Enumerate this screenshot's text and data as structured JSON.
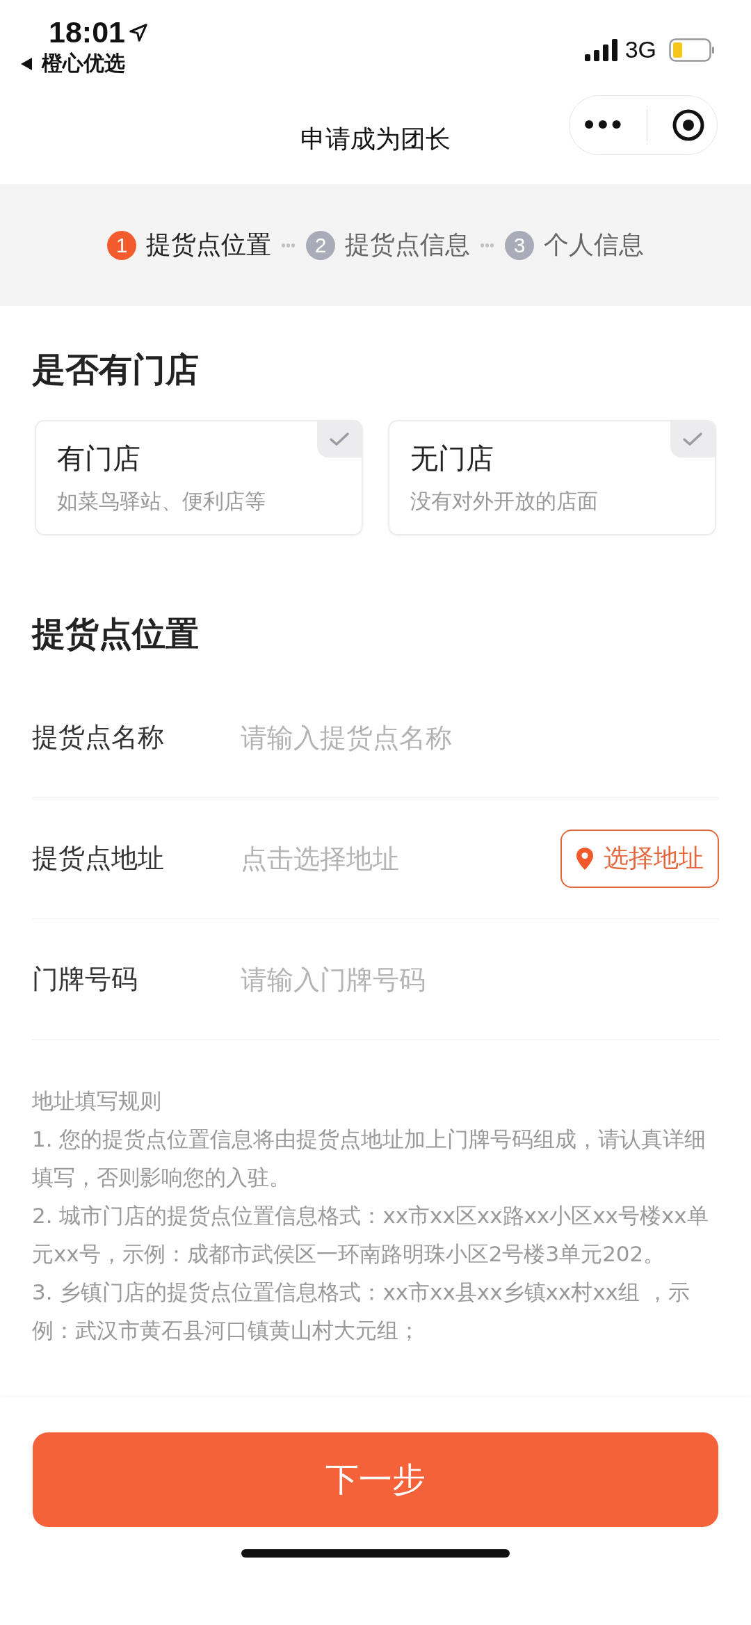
{
  "status_bar": {
    "time": "18:01",
    "back_app": "橙心优选",
    "network": "3G"
  },
  "nav": {
    "title": "申请成为团长",
    "menu_icon": "•••"
  },
  "steps": [
    {
      "number": "1",
      "label": "提货点位置",
      "selected": true
    },
    {
      "number": "2",
      "label": "提货点信息",
      "selected": false
    },
    {
      "number": "3",
      "label": "个人信息",
      "selected": false
    }
  ],
  "store_section": {
    "title": "是否有门店",
    "options": [
      {
        "title": "有门店",
        "subtitle": "如菜鸟驿站、便利店等",
        "selected": false
      },
      {
        "title": "无门店",
        "subtitle": "没有对外开放的店面",
        "selected": false
      }
    ]
  },
  "location_section": {
    "title": "提货点位置",
    "fields": [
      {
        "label": "提货点名称",
        "placeholder": "请输入提货点名称"
      },
      {
        "label": "提货点地址",
        "placeholder": "点击选择地址",
        "button": "选择地址"
      },
      {
        "label": "门牌号码",
        "placeholder": "请输入门牌号码"
      }
    ]
  },
  "rules": {
    "title": "地址填写规则",
    "items": [
      "1. 您的提货点位置信息将由提货点地址加上门牌号码组成，请认真详细填写，否则影响您的入驻。",
      "2. 城市门店的提货点位置信息格式：xx市xx区xx路xx小区xx号楼xx单元xx号，示例：成都市武侯区一环南路明珠小区2号楼3单元202。",
      "3. 乡镇门店的提货点位置信息格式：xx市xx县xx乡镇xx村xx组 ，示例：武汉市黄石县河口镇黄山村大元组；"
    ]
  },
  "next_button": "下一步"
}
